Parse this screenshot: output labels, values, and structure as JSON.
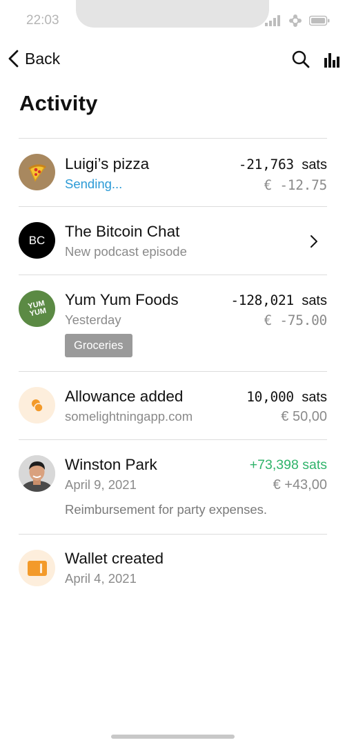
{
  "status_bar": {
    "time": "22:03"
  },
  "nav": {
    "back_label": "Back"
  },
  "page": {
    "title": "Activity"
  },
  "colors": {
    "accent_blue": "#2a9ad6",
    "positive_green": "#2fb36a",
    "orange": "#f39a2a",
    "avatar_pizza_bg": "#a8885f",
    "avatar_yumyum_bg": "#5b8a44",
    "avatar_bc_bg": "#000000",
    "tag_bg": "#9a9a9a"
  },
  "activity": [
    {
      "title": "Luigi’s pizza",
      "subtitle": "Sending...",
      "amount": "-21,763",
      "unit": "sats",
      "fiat": "€ -12.75",
      "icon": "pizza-icon"
    },
    {
      "avatar_text": "BC",
      "title": "The Bitcoin Chat",
      "subtitle": "New podcast episode",
      "icon": "chevron-right-icon"
    },
    {
      "avatar_text": "YUM YUM",
      "title": "Yum Yum Foods",
      "subtitle": "Yesterday",
      "amount": "-128,021",
      "unit": "sats",
      "fiat": "€ -75.00",
      "tag": "Groceries"
    },
    {
      "title": "Allowance added",
      "subtitle": "somelightningapp.com",
      "amount": "10,000",
      "unit": "sats",
      "fiat": "€ 50,00",
      "icon": "coins-icon"
    },
    {
      "title": "Winston Park",
      "subtitle": "April 9, 2021",
      "amount": "+73,398 sats",
      "fiat": "€ +43,00",
      "note": "Reimbursement for party expenses.",
      "icon": "person-avatar"
    },
    {
      "title": "Wallet created",
      "subtitle": "April 4, 2021",
      "icon": "wallet-icon"
    }
  ]
}
